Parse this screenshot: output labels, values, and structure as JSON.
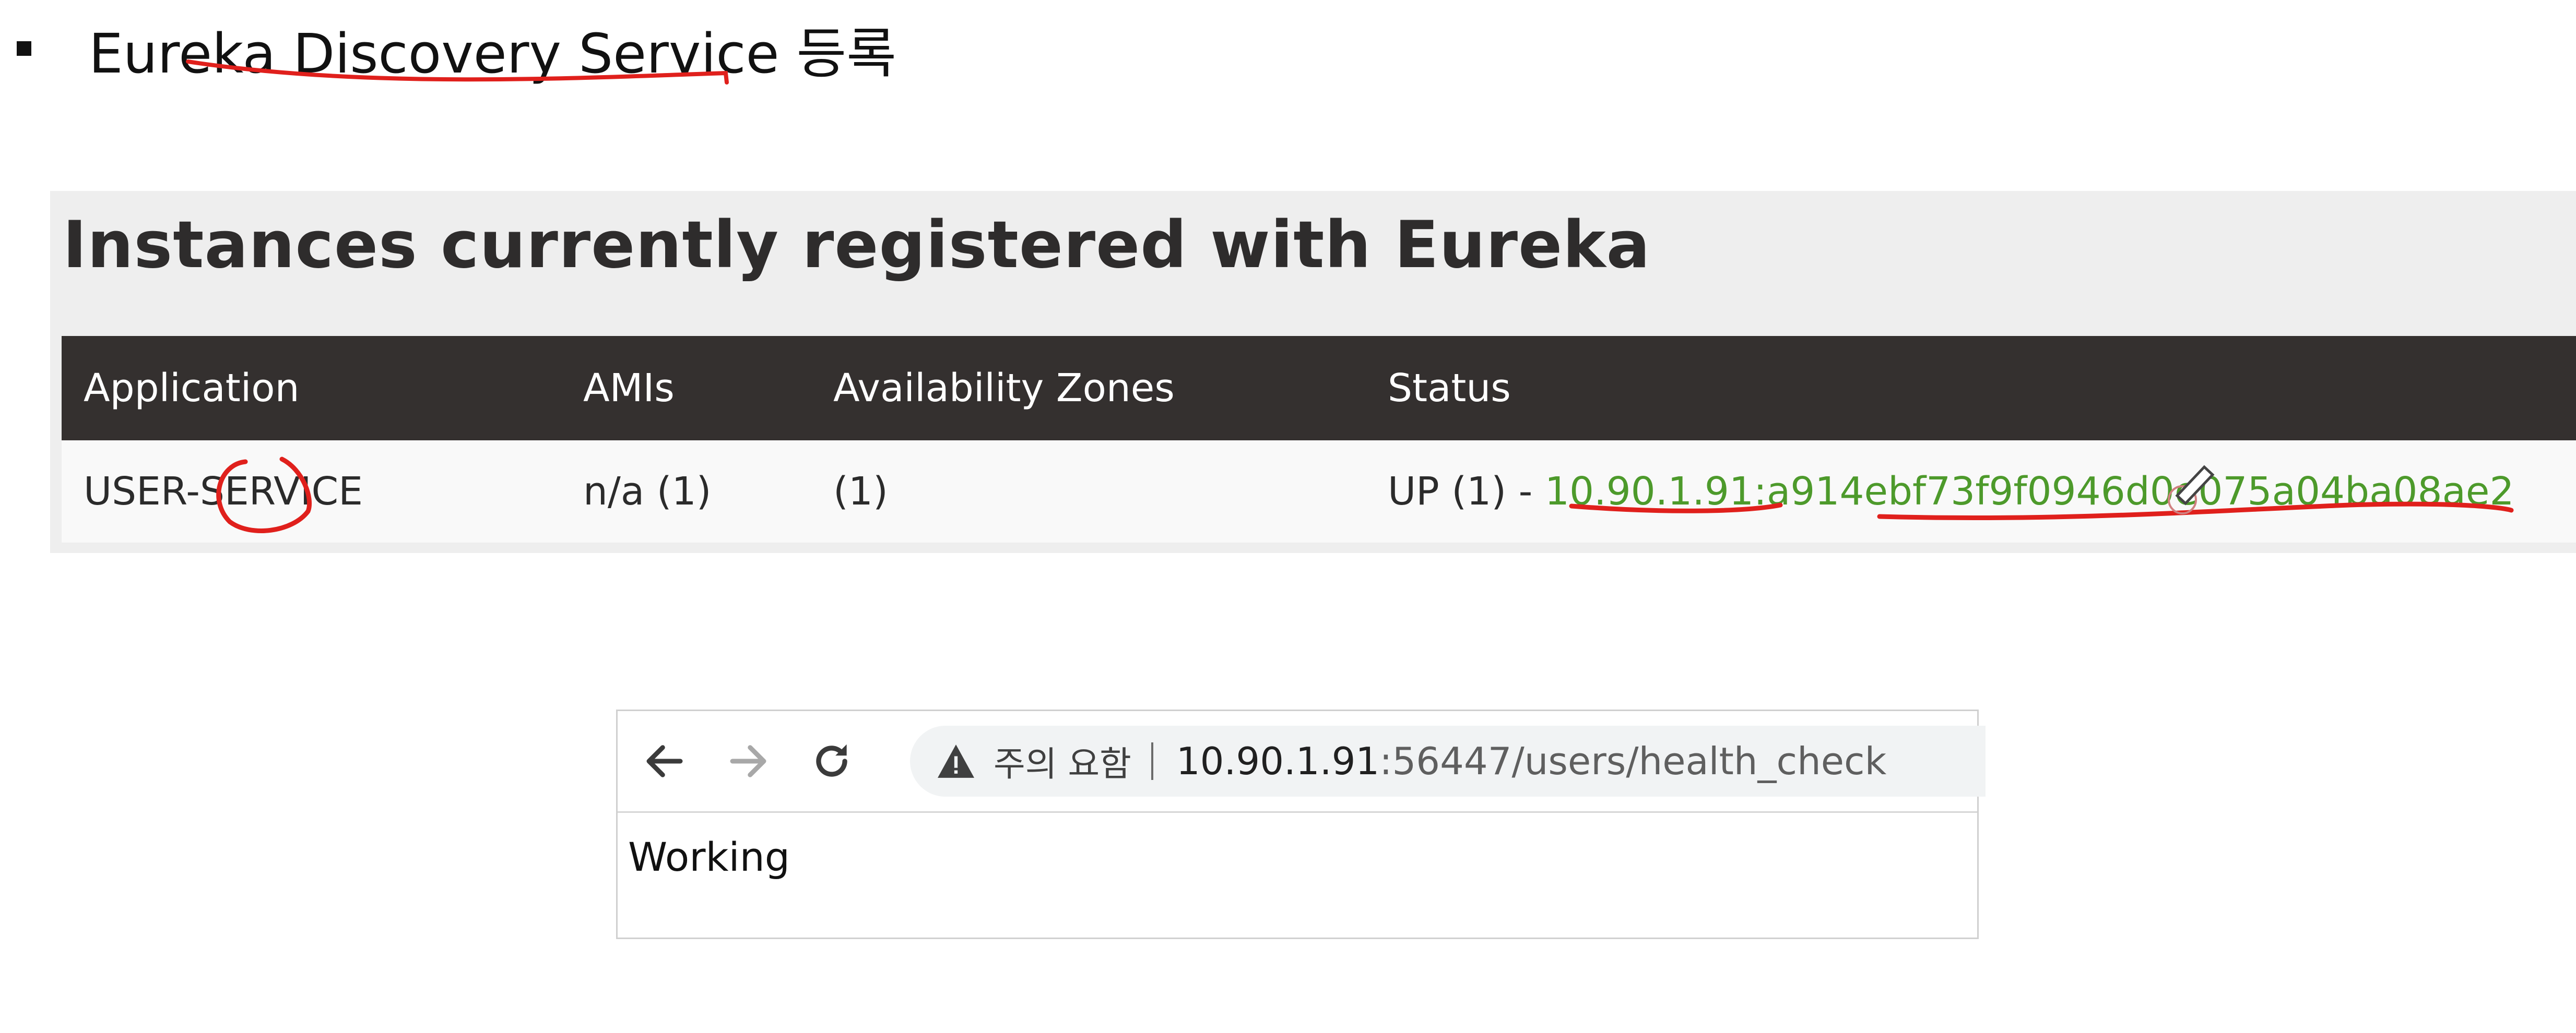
{
  "slide": {
    "title": "Eureka Discovery Service 등록"
  },
  "eureka": {
    "heading": "Instances currently registered with Eureka",
    "columns": [
      "Application",
      "AMIs",
      "Availability Zones",
      "Status"
    ],
    "rows": [
      {
        "application": "USER-SERVICE",
        "amis": "n/a (1)",
        "zones": "(1)",
        "status_prefix": "UP (1) - ",
        "instance_id": "10.90.1.91:a914ebf73f9f0946d0e075a04ba08ae2"
      }
    ]
  },
  "browser": {
    "back_icon": "arrow-left-icon",
    "forward_icon": "arrow-right-icon",
    "reload_icon": "reload-icon",
    "security_label": "주의 요함",
    "url_host": "10.90.1.91",
    "url_path": ":56447/users/health_check",
    "page_text": "Working"
  },
  "colors": {
    "annotation": "#e0201c",
    "status_link": "#4d9a2b",
    "table_header": "#34302f"
  }
}
